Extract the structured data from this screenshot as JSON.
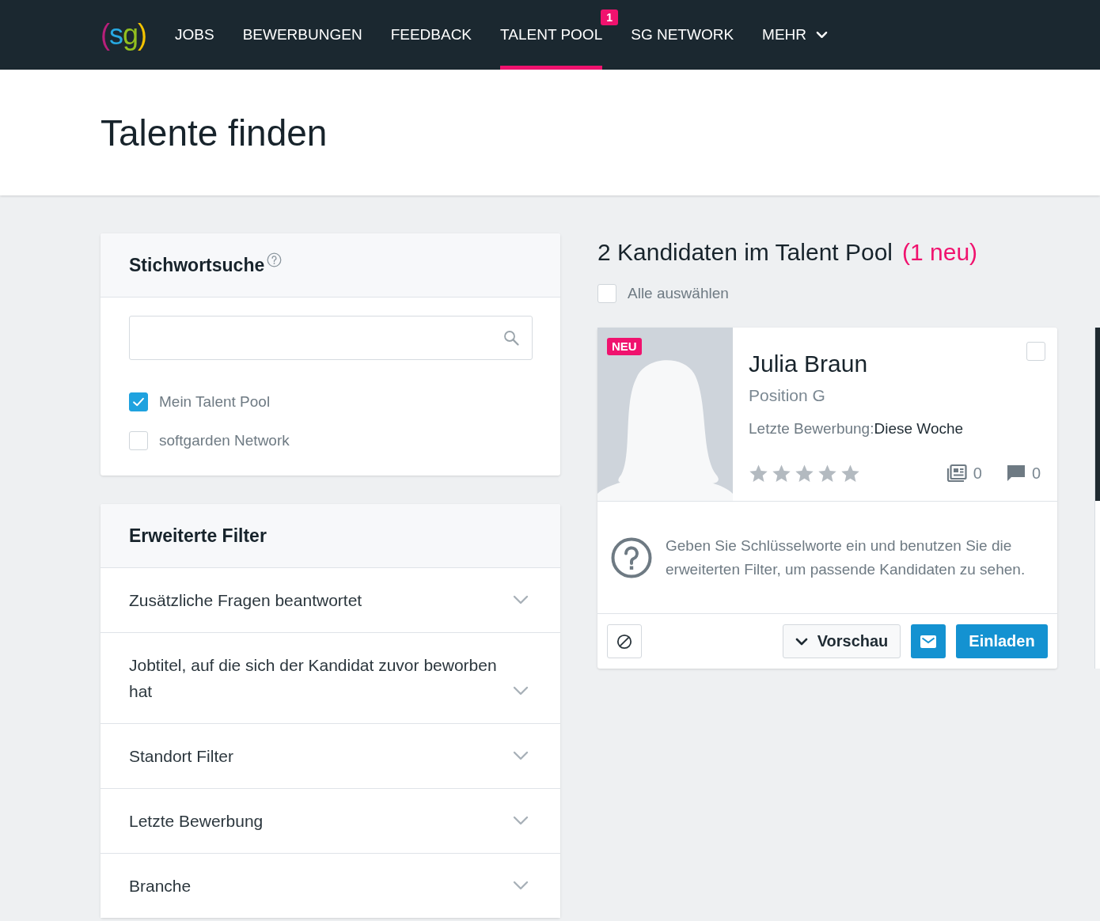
{
  "nav": {
    "logo": "(sg)",
    "items": [
      {
        "label": "JOBS",
        "selected": false,
        "kind": "link"
      },
      {
        "label": "BEWERBUNGEN",
        "selected": false,
        "kind": "link"
      },
      {
        "label": "FEEDBACK",
        "selected": false,
        "kind": "link"
      },
      {
        "label": "TALENT POOL",
        "selected": true,
        "kind": "link",
        "badge": "1"
      },
      {
        "label": "SG NETWORK",
        "selected": false,
        "kind": "link"
      },
      {
        "label": "MEHR",
        "selected": false,
        "kind": "menu"
      }
    ]
  },
  "page_title": "Talente finden",
  "keyword_search": {
    "title": "Stichwortsuche",
    "options": [
      {
        "label": "Mein Talent Pool",
        "checked": true
      },
      {
        "label": "softgarden Network",
        "checked": false
      }
    ]
  },
  "advanced_filters": {
    "title": "Erweiterte Filter",
    "items": [
      {
        "label": "Zusätzliche Fragen beantwortet",
        "expanded": false
      },
      {
        "label": "Jobtitel, auf die sich der Kandidat zuvor beworben hat",
        "expanded": false
      },
      {
        "label": "Standort Filter",
        "expanded": false
      },
      {
        "label": "Letzte Bewerbung",
        "expanded": false
      },
      {
        "label": "Branche",
        "expanded": false
      }
    ]
  },
  "results": {
    "title": "2 Kandidaten im Talent Pool",
    "new_count": "(1 neu)",
    "select_all": {
      "label": "Alle auswählen",
      "checked": false
    }
  },
  "candidates": [
    {
      "kind": "card",
      "name": "Julia Braun",
      "badge": "NEU",
      "position": "Position G",
      "last_application_label": "Letzte Bewerbung:",
      "last_application_value": "Diese Woche",
      "stars": 0,
      "checked": false,
      "documents": "0",
      "comments": "0",
      "hint": "Geben Sie Schlüsselworte ein und benutzen Sie die erweiterten Filter, um passende Kandidaten zu sehen.",
      "preview_button": "Vorschau",
      "invite_button": "Einladen"
    },
    {
      "kind": "cut_off"
    }
  ]
}
